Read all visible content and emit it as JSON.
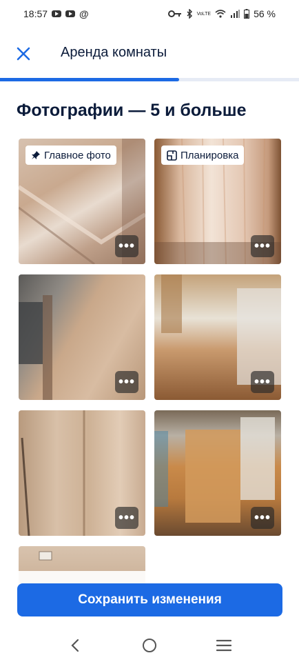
{
  "status_bar": {
    "time": "18:57",
    "network_label": "VoLTE",
    "battery_percent": "56 %"
  },
  "header": {
    "title": "Аренда комнаты",
    "close_icon": "close-icon"
  },
  "progress": {
    "value": 0.6
  },
  "section": {
    "title": "Фотографии — 5 и больше"
  },
  "photos": [
    {
      "label": "Главное фото",
      "label_icon": "pin-icon",
      "more": "•••"
    },
    {
      "label": "Планировка",
      "label_icon": "floorplan-icon",
      "more": "•••"
    },
    {
      "label": "",
      "more": "•••"
    },
    {
      "label": "",
      "more": "•••"
    },
    {
      "label": "",
      "more": "•••"
    },
    {
      "label": "",
      "more": "•••"
    },
    {
      "label": "",
      "more": ""
    }
  ],
  "footer": {
    "save_label": "Сохранить изменения",
    "accent_color": "#1c6ae4"
  },
  "nav": {
    "back_icon": "back-icon",
    "home_icon": "home-icon",
    "recents_icon": "recents-icon"
  }
}
